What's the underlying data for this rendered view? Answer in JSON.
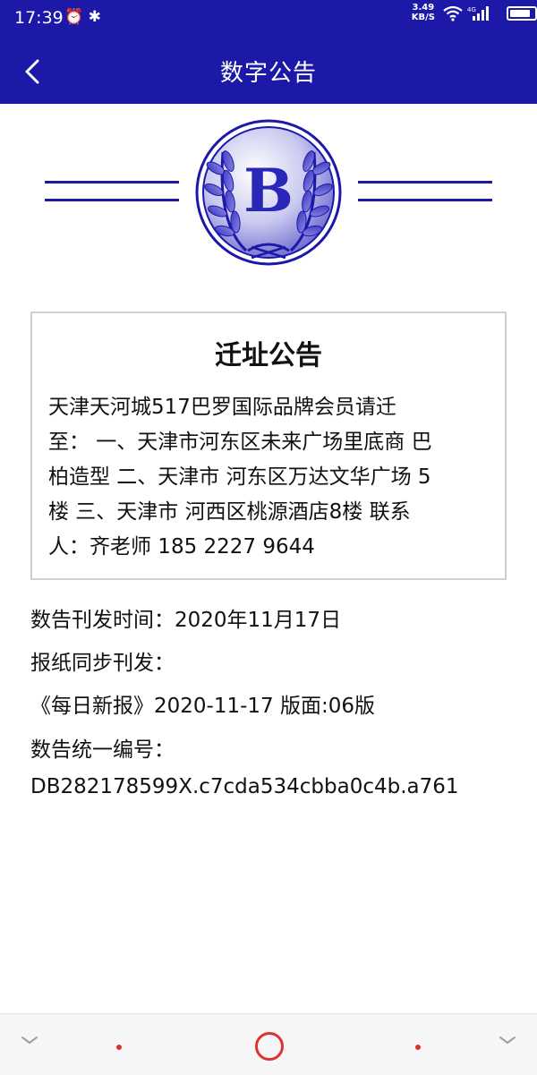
{
  "status_bar": {
    "time": "17:39",
    "left_icons": "⏰ ✱",
    "net_speed_value": "3.49",
    "net_speed_unit": "KB/S",
    "network_label": "4G",
    "battery_level": 0.85
  },
  "header": {
    "title": "数字公告",
    "back_icon": "chevron-left-icon"
  },
  "logo": {
    "letter": "B",
    "primary_color": "#1c19a8"
  },
  "notice": {
    "title": "迁址公告",
    "line1": "天津天河城517巴罗国际品牌会员请迁",
    "line2": "至： 一、天津市河东区未来广场里底商 巴",
    "line3": "柏造型 二、天津市 河东区万达文华广场 5",
    "line4": "楼 三、天津市 河西区桃源酒店8楼 联系",
    "line5": "人：齐老师 185 2227 9644"
  },
  "meta": {
    "publish_time": "数告刊发时间：2020年11月17日",
    "sync_label": "报纸同步刊发：",
    "newspaper": "《每日新报》2020-11-17 版面:06版",
    "id_label": "数告统一编号：",
    "id_value": "DB282178599X.c7cda534cbba0c4b.a761"
  },
  "colors": {
    "brand": "#1c19a8",
    "nav_accent": "#e03131"
  }
}
